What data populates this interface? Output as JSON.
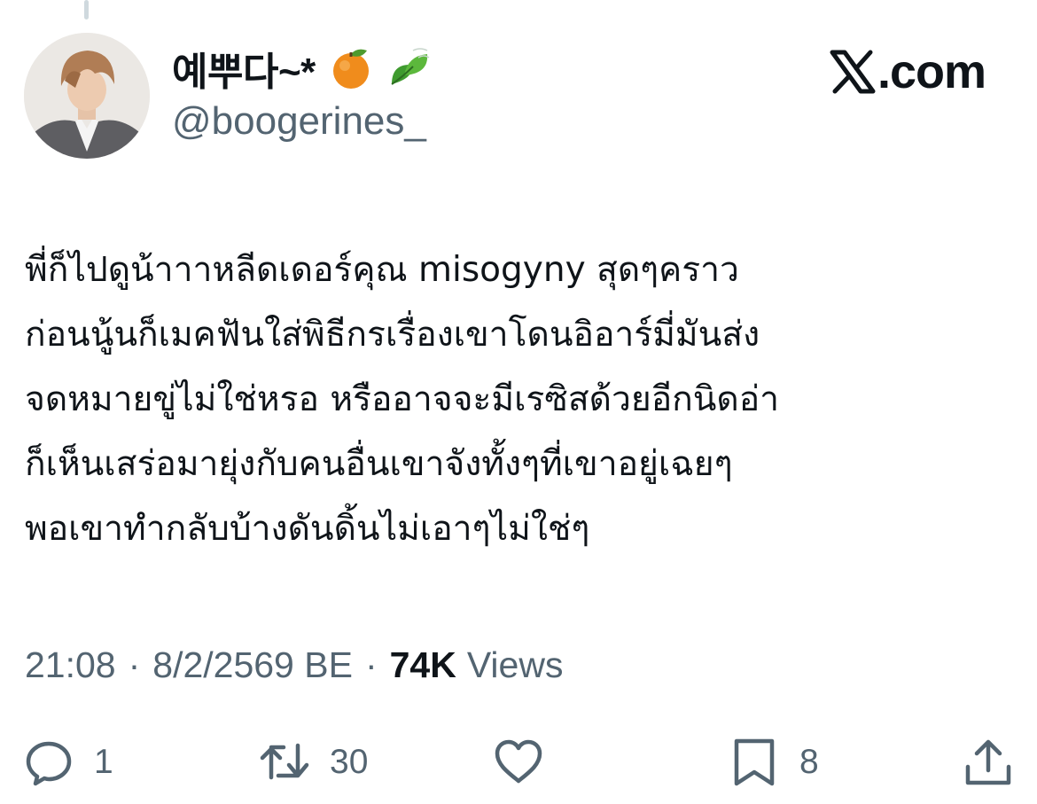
{
  "tweet": {
    "author": {
      "display_name": "예뿌다~*",
      "handle": "@boogerines_",
      "name_emojis": [
        "tangerine-emoji",
        "leaf-emoji"
      ]
    },
    "site": {
      "name": ".com",
      "icon": "x-logo-icon"
    },
    "text_lines": [
      "พี่ก็ไปดูน้าาาหลีดเดอร์คุณ misogyny สุดๆคราว",
      "ก่อนนู้นก็เมคฟันใส่พิธีกรเรื่องเขาโดนอิอาร์มี่มันส่ง",
      "จดหมายขู่ไม่ใช่หรอ หรืออาจจะมีเรซิสด้วยอีกนิดอ่า",
      "ก็เห็นเสร่อมายุ่งกับคนอื่นเขาจังทั้งๆที่เขาอยู่เฉยๆ",
      "พอเขาทำกลับบ้างดันดิ้นไม่เอาๆไม่ใช่ๆ"
    ],
    "time": "21:08",
    "separator": "·",
    "date": "8/2/2569 BE",
    "views_count": "74K",
    "views_label": "Views"
  },
  "actions": {
    "reply": {
      "icon": "reply-icon",
      "count": "1"
    },
    "retweet": {
      "icon": "retweet-icon",
      "count": "30"
    },
    "like": {
      "icon": "heart-icon",
      "count": ""
    },
    "bookmark": {
      "icon": "bookmark-icon",
      "count": "8"
    },
    "share": {
      "icon": "share-icon"
    }
  },
  "colors": {
    "text_primary": "#0f1419",
    "text_secondary": "#536471",
    "background": "#ffffff"
  }
}
